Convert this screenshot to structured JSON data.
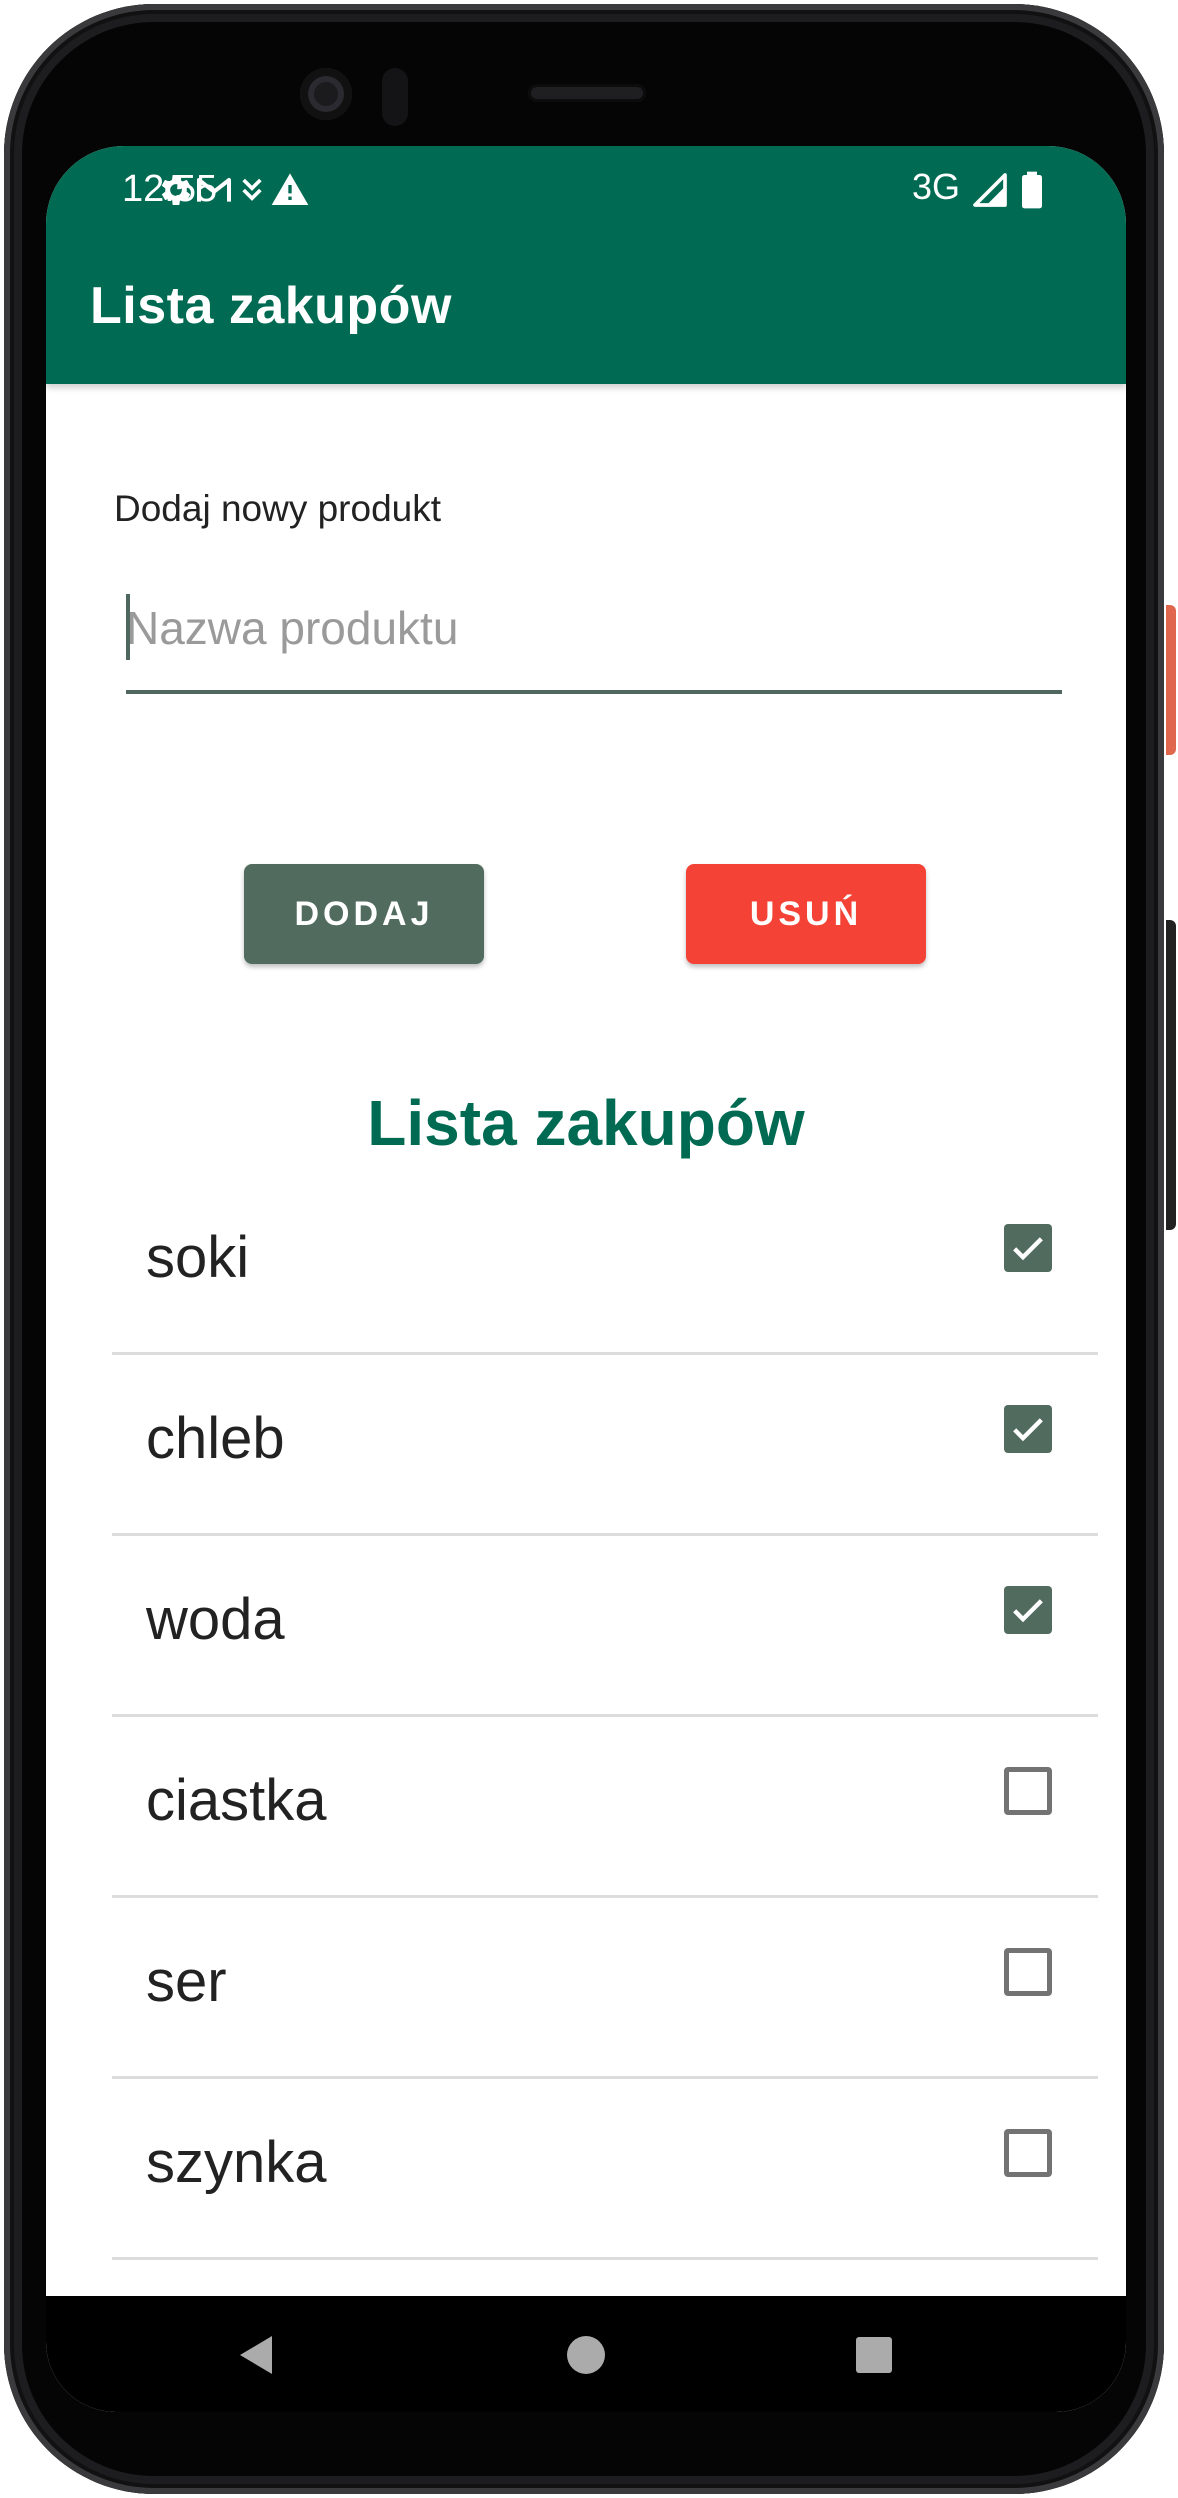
{
  "status_bar": {
    "time": "12:55",
    "network": "3G",
    "icons": [
      "settings-icon",
      "gmail-icon",
      "usb-debug-icon",
      "warning-icon",
      "signal-icon",
      "battery-icon"
    ]
  },
  "app_bar": {
    "title": "Lista zakupów"
  },
  "form": {
    "label": "Dodaj nowy produkt",
    "input_value": "",
    "input_placeholder": "Nazwa produktu",
    "add_button": "DODAJ",
    "remove_button": "USUŃ"
  },
  "list": {
    "title": "Lista zakupów",
    "items": [
      {
        "label": "soki",
        "checked": true
      },
      {
        "label": "chleb",
        "checked": true
      },
      {
        "label": "woda",
        "checked": true
      },
      {
        "label": "ciastka",
        "checked": false
      },
      {
        "label": "ser",
        "checked": false
      },
      {
        "label": "szynka",
        "checked": false
      }
    ]
  },
  "nav_bar": {
    "icons": [
      "back-icon",
      "home-icon",
      "recents-icon"
    ]
  },
  "colors": {
    "primary": "#006b52",
    "add_button": "#516b5f",
    "remove_button": "#f44336",
    "checkbox_checked": "#516b5f"
  }
}
